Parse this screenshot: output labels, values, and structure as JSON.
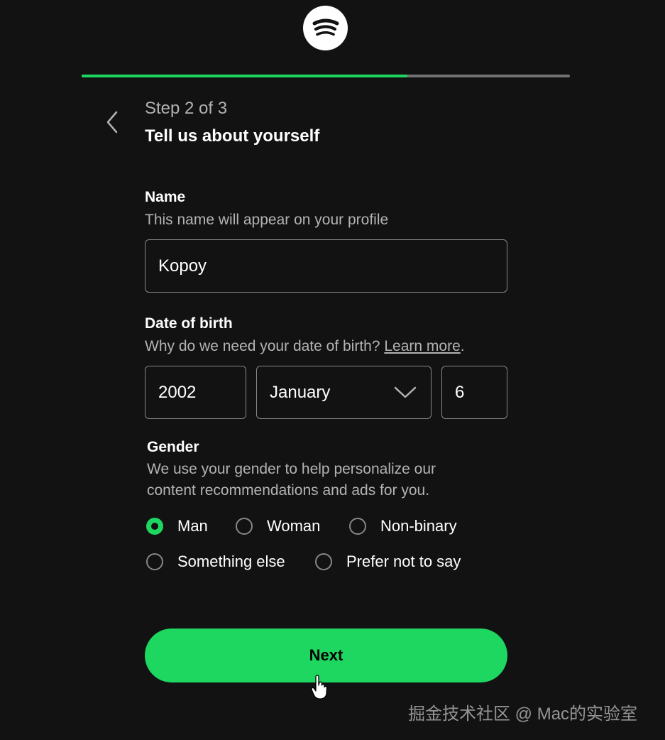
{
  "header": {
    "logo_icon": "spotify-logo-icon",
    "progress": {
      "step": 2,
      "total": 3,
      "fraction": 0.667
    }
  },
  "step": {
    "back_icon": "chevron-left-icon",
    "label": "Step 2 of 3",
    "title": "Tell us about yourself"
  },
  "name_field": {
    "label": "Name",
    "help": "This name will appear on your profile",
    "value": "Kopoy"
  },
  "dob_field": {
    "label": "Date of birth",
    "help": "Why do we need your date of birth?",
    "learn_more": "Learn more",
    "help_suffix": ".",
    "year": "2002",
    "month": "January",
    "day": "6",
    "month_icon": "chevron-down-icon"
  },
  "gender_field": {
    "label": "Gender",
    "help_line1": "We use your gender to help personalize our",
    "help_line2": "content recommendations and ads for you.",
    "options": [
      "Man",
      "Woman",
      "Non-binary",
      "Something else",
      "Prefer not to say"
    ],
    "selected": "Man"
  },
  "next_button": {
    "label": "Next"
  },
  "watermark": {
    "text": "掘金技术社区 @ Mac的实验室"
  },
  "colors": {
    "accent": "#1ed760",
    "background": "#121212",
    "border": "#878787",
    "muted_text": "#b3b3b3"
  }
}
